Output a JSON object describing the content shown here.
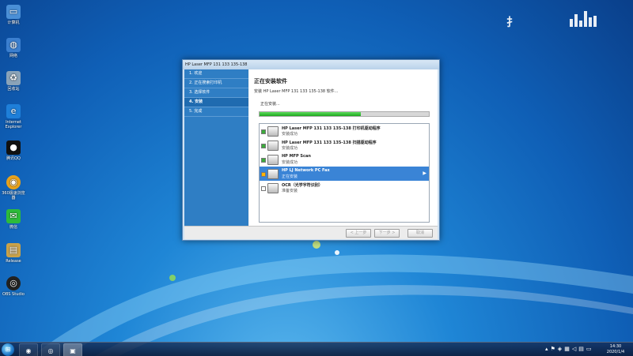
{
  "desktop": {
    "icons": [
      {
        "label": "计算机",
        "icon": "computer-icon",
        "color": "#4a8fd6"
      },
      {
        "label": "网络",
        "icon": "network-icon",
        "color": "#3b7fcf"
      },
      {
        "label": "回收站",
        "icon": "recycle-bin-icon",
        "color": "#8aa3b8"
      },
      {
        "label": "Internet Explorer",
        "icon": "ie-icon",
        "color": "#1e7fd9"
      },
      {
        "label": "腾讯QQ",
        "icon": "qq-icon",
        "color": "#111111"
      },
      {
        "label": "360极速浏览器",
        "icon": "browser-icon",
        "color": "#e8a21c"
      },
      {
        "label": "微信",
        "icon": "wechat-icon",
        "color": "#2dbb3a"
      },
      {
        "label": "Release",
        "icon": "archive-icon",
        "color": "#c9a24a"
      },
      {
        "label": "OBS Studio",
        "icon": "obs-icon",
        "color": "#222222"
      }
    ],
    "overlay_text": "扌"
  },
  "window": {
    "title": "HP Laser MFP 131 133 135-138",
    "steps": [
      {
        "label": "1. 欢迎",
        "active": false
      },
      {
        "label": "2. 正在搜索打印机",
        "active": false
      },
      {
        "label": "3. 选择软件",
        "active": false
      },
      {
        "label": "4. 安装",
        "active": true
      },
      {
        "label": "5. 完成",
        "active": false
      }
    ],
    "heading": "正在安装软件",
    "subtitle": "安装 HP Laser MFP 131 133 135-138 软件...",
    "status": "正在安装...",
    "progress": 0.6,
    "items": [
      {
        "name": "HP Laser MFP 131 133 135-138 打印机驱动程序",
        "status": "安装成功",
        "state": "done",
        "icon": "printer-icon"
      },
      {
        "name": "HP Laser MFP 131 133 135-138 扫描驱动程序",
        "status": "安装成功",
        "state": "done",
        "icon": "scanner-icon"
      },
      {
        "name": "HP MFP Scan",
        "status": "安装成功",
        "state": "done",
        "icon": "scan-app-icon"
      },
      {
        "name": "HP LJ Network PC Fax",
        "status": "正在安装",
        "state": "running",
        "icon": "fax-icon"
      },
      {
        "name": "OCR（光学字符识别）",
        "status": "准备安装",
        "state": "pending",
        "icon": "ocr-icon"
      }
    ],
    "buttons": {
      "back": "< 上一步",
      "next": "下一步 >",
      "cancel": "取消"
    }
  },
  "taskbar": {
    "start_icon": "windows-start-icon",
    "clock_time": "14:30",
    "clock_date": "2020/1/4"
  }
}
